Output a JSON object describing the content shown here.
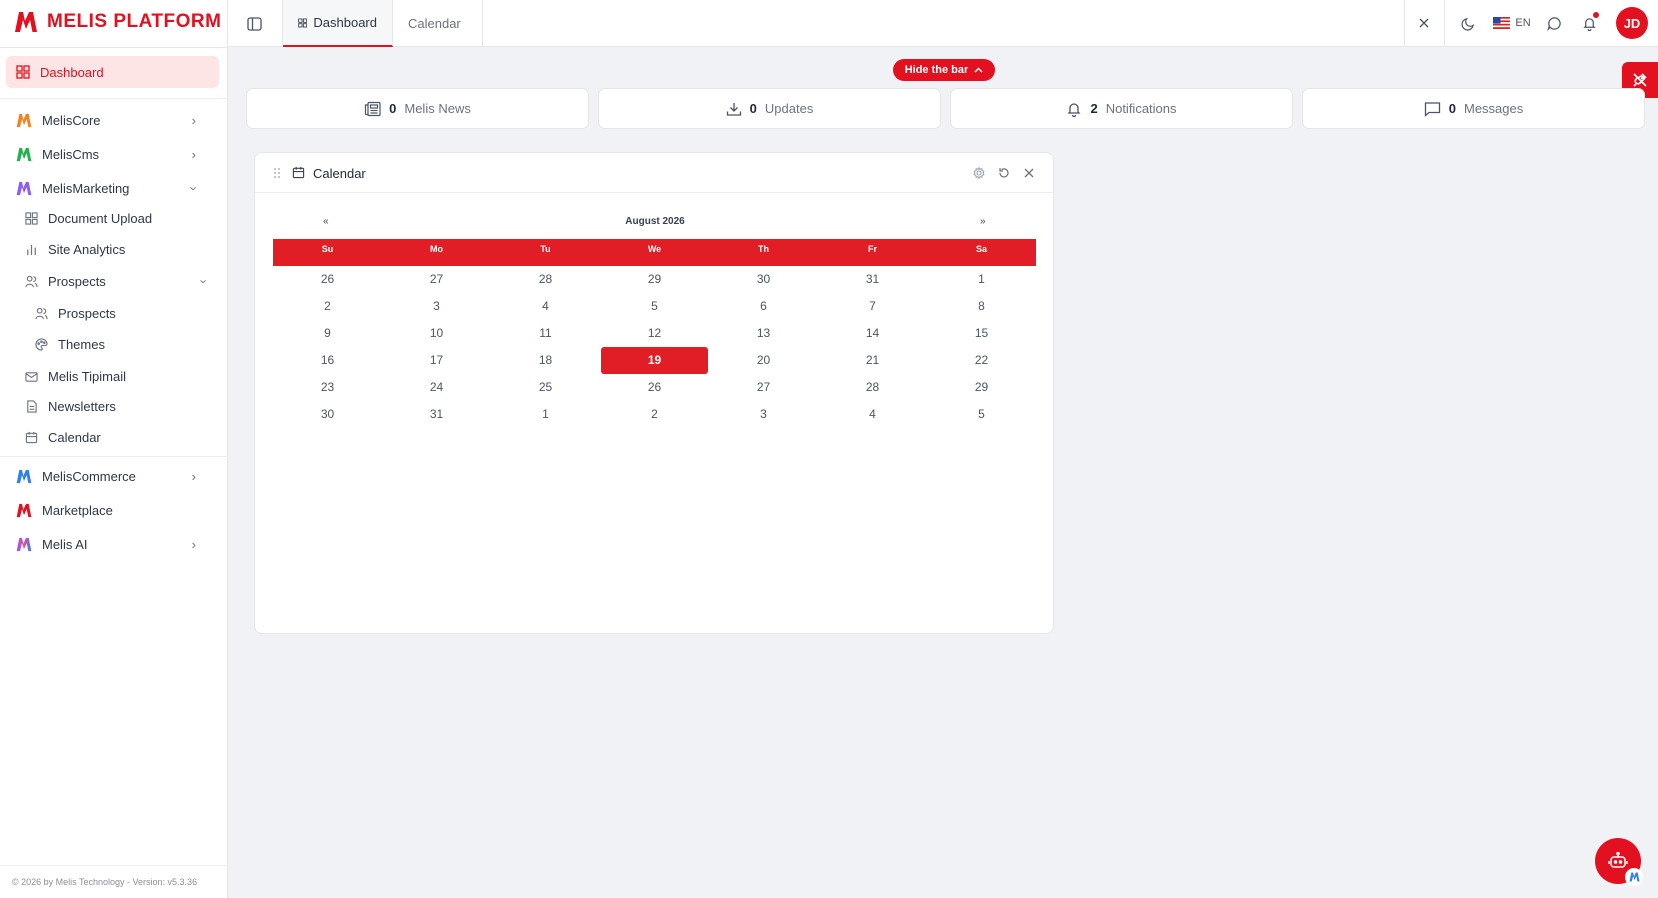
{
  "brand": {
    "name": "MELIS PLATFORM",
    "accent": "#e3101f"
  },
  "sidebar": {
    "items": [
      {
        "label": "Dashboard",
        "icon": "grid-icon"
      },
      {
        "label": "MelisCore",
        "icon": "melis-logo-orange",
        "color": "#f58220"
      },
      {
        "label": "MelisCms",
        "icon": "melis-logo-green",
        "color": "#22b14c"
      },
      {
        "label": "MelisMarketing",
        "icon": "melis-logo-purple",
        "color": "#8b5cf6"
      },
      {
        "label": "Document Upload",
        "icon": "grid-icon"
      },
      {
        "label": "Site Analytics",
        "icon": "bar-chart-icon"
      },
      {
        "label": "Prospects",
        "icon": "users-icon"
      },
      {
        "label": "Prospects",
        "icon": "users-icon"
      },
      {
        "label": "Themes",
        "icon": "palette-icon"
      },
      {
        "label": "Melis Tipimail",
        "icon": "mail-icon"
      },
      {
        "label": "Newsletters",
        "icon": "document-icon"
      },
      {
        "label": "Calendar",
        "icon": "calendar-icon"
      },
      {
        "label": "MelisCommerce",
        "icon": "melis-logo-blue",
        "color": "#2f80ed"
      },
      {
        "label": "Marketplace",
        "icon": "melis-logo-red",
        "color": "#e3101f"
      },
      {
        "label": "Melis AI",
        "icon": "melis-logo-gradient"
      }
    ],
    "footer": "© 2026 by Melis Technology - Version: v5.3.36"
  },
  "topbar": {
    "tabs": [
      {
        "label": "Dashboard",
        "icon": "grid-icon"
      },
      {
        "label": "Calendar"
      }
    ],
    "language": "EN",
    "avatar": "JD"
  },
  "hide_bar": {
    "label": "Hide the bar"
  },
  "stats": [
    {
      "count": "0",
      "label": "Melis News",
      "icon": "news-icon"
    },
    {
      "count": "0",
      "label": "Updates",
      "icon": "download-icon"
    },
    {
      "count": "2",
      "label": "Notifications",
      "icon": "bell-icon"
    },
    {
      "count": "0",
      "label": "Messages",
      "icon": "message-icon"
    }
  ],
  "calendar": {
    "title": "Calendar",
    "month_label": "August 2026",
    "prev": "«",
    "next": "»",
    "weekdays": [
      "Su",
      "Mo",
      "Tu",
      "We",
      "Th",
      "Fr",
      "Sa"
    ],
    "weeks": [
      [
        "26",
        "27",
        "28",
        "29",
        "30",
        "31",
        "1"
      ],
      [
        "2",
        "3",
        "4",
        "5",
        "6",
        "7",
        "8"
      ],
      [
        "9",
        "10",
        "11",
        "12",
        "13",
        "14",
        "15"
      ],
      [
        "16",
        "17",
        "18",
        "19",
        "20",
        "21",
        "22"
      ],
      [
        "23",
        "24",
        "25",
        "26",
        "27",
        "28",
        "29"
      ],
      [
        "30",
        "31",
        "1",
        "2",
        "3",
        "4",
        "5"
      ]
    ],
    "today": "19"
  }
}
